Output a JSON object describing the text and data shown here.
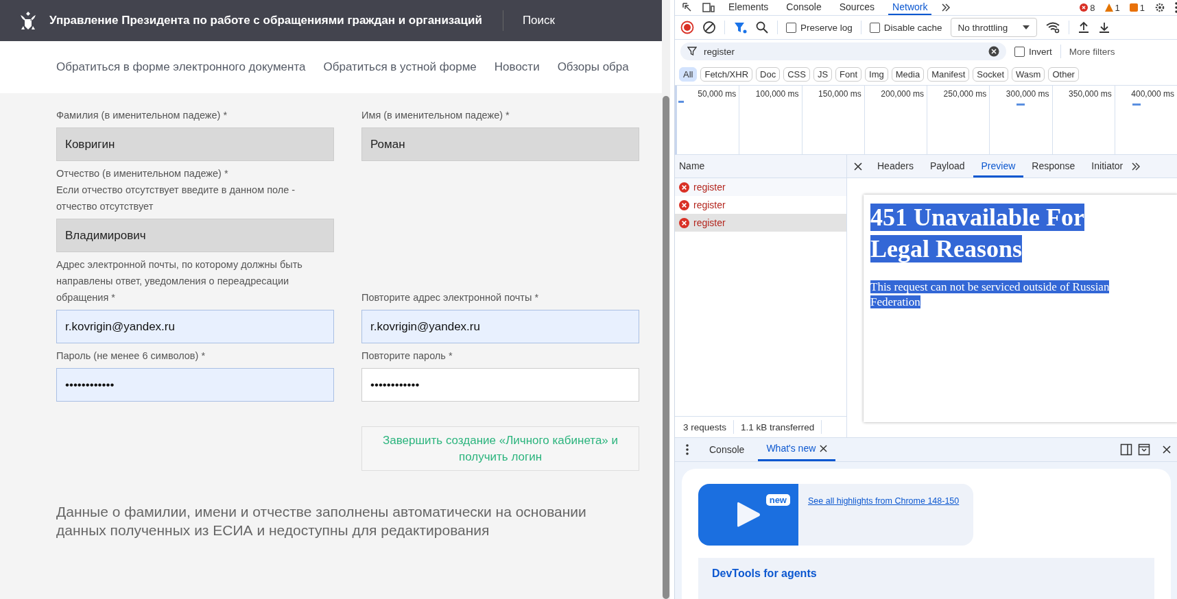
{
  "site": {
    "title": "Управление Президента по работе с обращениями граждан и организаций",
    "search": "Поиск",
    "nav": [
      {
        "label": "Обратиться в форме электронного документа"
      },
      {
        "label": "Обратиться в устной форме"
      },
      {
        "label": "Новости"
      },
      {
        "label": "Обзоры обра"
      }
    ]
  },
  "form": {
    "rows": [
      [
        {
          "label": "Фамилия (в именительном падеже) *",
          "value": "Ковригин",
          "disabled": true,
          "autofilled": false
        },
        {
          "label": "Имя (в именительном падеже) *",
          "value": "Роман",
          "disabled": true,
          "autofilled": false
        }
      ],
      [
        {
          "label": "Отчество (в именительном падеже) *\nЕсли отчество отсутствует введите в данном поле - отчество отсутствует",
          "value": "Владимирович",
          "disabled": true,
          "autofilled": false
        }
      ],
      [
        {
          "label": "Адрес электронной почты, по которому должны быть направлены ответ, уведомления о переадресации обращения *",
          "value": "r.kovrigin@yandex.ru",
          "disabled": false,
          "autofilled": true
        },
        {
          "label": "Повторите адрес электронной почты *",
          "value": "r.kovrigin@yandex.ru",
          "disabled": false,
          "autofilled": true
        }
      ],
      [
        {
          "label": "Пароль (не менее 6 символов) *",
          "value": "••••••••••••",
          "disabled": false,
          "autofilled": true
        },
        {
          "label": "Повторите пароль *",
          "value": "••••••••••••",
          "disabled": false,
          "autofilled": false
        }
      ]
    ],
    "submit": "Завершить создание «Личного кабинета» и получить логин",
    "note": "Данные о фамилии, имени и отчестве заполнены автоматически на основании данных полученных из ЕСИА и недоступны для редактирования"
  },
  "devtools": {
    "tabs": [
      {
        "label": "Elements",
        "selected": false
      },
      {
        "label": "Console",
        "selected": false
      },
      {
        "label": "Sources",
        "selected": false
      },
      {
        "label": "Network",
        "selected": true
      }
    ],
    "errors": "8",
    "warnings": "1",
    "issues": "1",
    "toolbar": {
      "preserve_log": {
        "label": "Preserve log",
        "checked": false
      },
      "disable_cache": {
        "label": "Disable cache",
        "checked": false
      },
      "throttling": "No throttling"
    },
    "filter": {
      "value": "register",
      "invert": {
        "label": "Invert",
        "checked": false
      },
      "more": "More filters"
    },
    "types": [
      {
        "label": "All",
        "selected": true
      },
      {
        "label": "Fetch/XHR",
        "selected": false
      },
      {
        "label": "Doc",
        "selected": false
      },
      {
        "label": "CSS",
        "selected": false
      },
      {
        "label": "JS",
        "selected": false
      },
      {
        "label": "Font",
        "selected": false
      },
      {
        "label": "Img",
        "selected": false
      },
      {
        "label": "Media",
        "selected": false
      },
      {
        "label": "Manifest",
        "selected": false
      },
      {
        "label": "Socket",
        "selected": false
      },
      {
        "label": "Wasm",
        "selected": false
      },
      {
        "label": "Other",
        "selected": false
      }
    ],
    "timeline_ticks": [
      "50,000 ms",
      "100,000 ms",
      "150,000 ms",
      "200,000 ms",
      "250,000 ms",
      "300,000 ms",
      "350,000 ms",
      "400,000 ms"
    ],
    "name_header": "Name",
    "requests": [
      {
        "name": "register",
        "selected": false
      },
      {
        "name": "register",
        "selected": false
      },
      {
        "name": "register",
        "selected": true
      }
    ],
    "detail_tabs": [
      {
        "label": "Headers",
        "selected": false
      },
      {
        "label": "Payload",
        "selected": false
      },
      {
        "label": "Preview",
        "selected": true
      },
      {
        "label": "Response",
        "selected": false
      },
      {
        "label": "Initiator",
        "selected": false
      }
    ],
    "preview": {
      "heading": "451 Unavailable For Legal Reasons",
      "body": "This request can not be serviced outside of Russian Federation",
      "highlighted": true
    },
    "summary": {
      "requests": "3 requests",
      "transferred": "1.1 kB transferred"
    },
    "drawer_tabs": [
      {
        "label": "Console",
        "selected": false,
        "closable": false
      },
      {
        "label": "What's new",
        "selected": true,
        "closable": true
      }
    ],
    "whats_new": {
      "badge": "new",
      "link": "See all highlights from Chrome 148-150",
      "card_title": "DevTools for agents"
    }
  }
}
